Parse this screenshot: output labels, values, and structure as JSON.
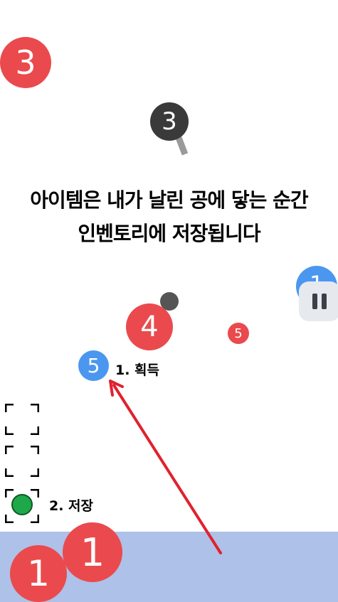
{
  "tutorial": {
    "line1": "아이템은 내가 날린 공에 닿는 순간",
    "line2": "인벤토리에 저장됩니다",
    "step1": "1. 획득",
    "step2": "2. 저장"
  },
  "balls": {
    "top_left": "3",
    "magnifier": "3",
    "mid_red_large": "4",
    "mid_red_small": "5",
    "blue_item": "5",
    "right_blue": "1",
    "ground_left": "1",
    "ground_right": "1"
  },
  "colors": {
    "red": "#ea4a4d",
    "blue": "#4b97f0",
    "ground": "#aec1e8",
    "arrow": "#e0222e",
    "slot_item": "#1fa84a"
  },
  "icons": {
    "pause": "pause-icon",
    "magnifier": "magnifier-icon",
    "arrow": "arrow-up-left-icon"
  }
}
